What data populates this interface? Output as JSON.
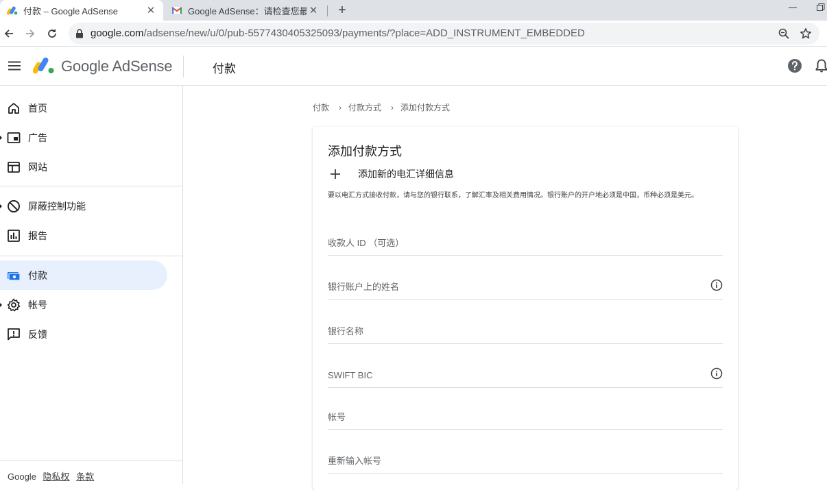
{
  "browser": {
    "tabs": [
      {
        "title": "付款 – Google AdSense",
        "favicon": "adsense-logo"
      },
      {
        "title": "Google AdSense：请检查您最近",
        "favicon": "gmail-logo"
      }
    ],
    "new_tab": "+",
    "close": "✕",
    "url_host": "google.com",
    "url_path": "/adsense/new/u/0/pub-5577430405325093/payments/?place=ADD_INSTRUMENT_EMBEDDED"
  },
  "header": {
    "brand": "Google AdSense",
    "page_title": "付款"
  },
  "sidebar": {
    "items": [
      {
        "label": "首页",
        "icon": "home-icon",
        "caret": false,
        "active": false
      },
      {
        "label": "广告",
        "icon": "ads-icon",
        "caret": true,
        "active": false
      },
      {
        "label": "网站",
        "icon": "sites-icon",
        "caret": false,
        "active": false
      },
      {
        "label": "屏蔽控制功能",
        "icon": "block-icon",
        "caret": true,
        "active": false
      },
      {
        "label": "报告",
        "icon": "reports-icon",
        "caret": false,
        "active": false
      },
      {
        "label": "付款",
        "icon": "payments-icon",
        "caret": false,
        "active": true
      },
      {
        "label": "帐号",
        "icon": "account-gear-icon",
        "caret": true,
        "active": false
      },
      {
        "label": "反馈",
        "icon": "feedback-icon",
        "caret": false,
        "active": false
      }
    ],
    "footer": {
      "google": "Google",
      "privacy": "隐私权",
      "terms": "条款"
    }
  },
  "breadcrumb": [
    "付款",
    "付款方式",
    "添加付款方式"
  ],
  "form": {
    "title": "添加付款方式",
    "add_label": "添加新的电汇详细信息",
    "note": "要以电汇方式接收付款，请与您的银行联系，了解汇率及相关费用情况。银行账户的开户地必须是中国，币种必须是美元。",
    "fields": [
      {
        "placeholder": "收款人 ID （可选）",
        "value": "",
        "info": false
      },
      {
        "placeholder": "银行账户上的姓名",
        "value": "",
        "info": true
      },
      {
        "placeholder": "银行名称",
        "value": "",
        "info": false
      },
      {
        "placeholder": "SWIFT BIC",
        "value": "",
        "info": true
      },
      {
        "placeholder": "帐号",
        "value": "",
        "info": false
      },
      {
        "placeholder": "重新输入帐号",
        "value": "",
        "info": false
      }
    ]
  },
  "colors": {
    "active_nav_bg": "#e8f0fe",
    "payments_icon": "#1a73e8"
  }
}
